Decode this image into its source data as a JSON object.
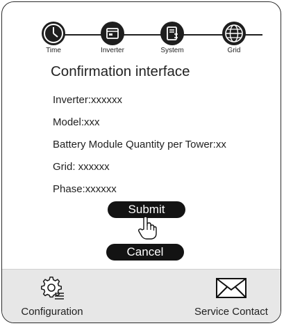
{
  "steps": [
    {
      "label": "Time",
      "icon": "clock-icon"
    },
    {
      "label": "Inverter",
      "icon": "inverter-icon"
    },
    {
      "label": "System",
      "icon": "battery-system-icon"
    },
    {
      "label": "Grid",
      "icon": "globe-icon"
    }
  ],
  "page_title": "Confirmation interface",
  "fields": {
    "inverter": "Inverter:xxxxxx",
    "model": "Model:xxx",
    "battery": "Battery Module Quantity per Tower:xx",
    "grid": "Grid: xxxxxx",
    "phase": "Phase:xxxxxx"
  },
  "buttons": {
    "submit": "Submit",
    "cancel": "Cancel"
  },
  "bottom_bar": {
    "configuration": {
      "label": "Configuration",
      "icon": "gear-settings-icon"
    },
    "service": {
      "label": "Service Contact",
      "icon": "envelope-icon"
    }
  },
  "colors": {
    "accent": "#131313",
    "bottom_bar": "#e7e7e7"
  }
}
